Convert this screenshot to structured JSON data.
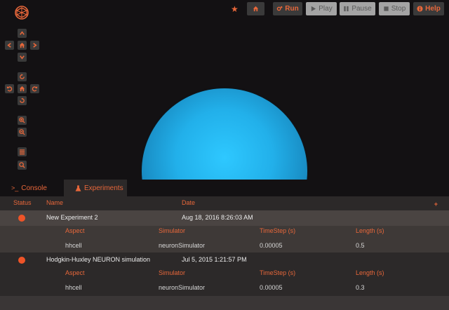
{
  "topbar": {
    "run_label": "Run",
    "play_label": "Play",
    "pause_label": "Pause",
    "stop_label": "Stop",
    "help_label": "Help",
    "accent_color": "#e8673a"
  },
  "tabs": [
    {
      "label": "Console",
      "icon": "terminal-icon"
    },
    {
      "label": "Experiments",
      "icon": "flask-icon",
      "active": true
    }
  ],
  "table": {
    "headers": {
      "status": "Status",
      "name": "Name",
      "date": "Date"
    },
    "sub_headers": {
      "aspect": "Aspect",
      "simulator": "Simulator",
      "timestep": "TimeStep (s)",
      "length": "Length (s)"
    },
    "experiments": [
      {
        "name": "New Experiment 2",
        "date": "Aug 18, 2016 8:26:03 AM",
        "aspect": "hhcell",
        "simulator": "neuronSimulator",
        "timestep": "0.00005",
        "length": "0.5"
      },
      {
        "name": "Hodgkin-Huxley NEURON simulation",
        "date": "Jul 5, 2015 1:21:57 PM",
        "aspect": "hhcell",
        "simulator": "neuronSimulator",
        "timestep": "0.00005",
        "length": "0.3"
      }
    ]
  }
}
